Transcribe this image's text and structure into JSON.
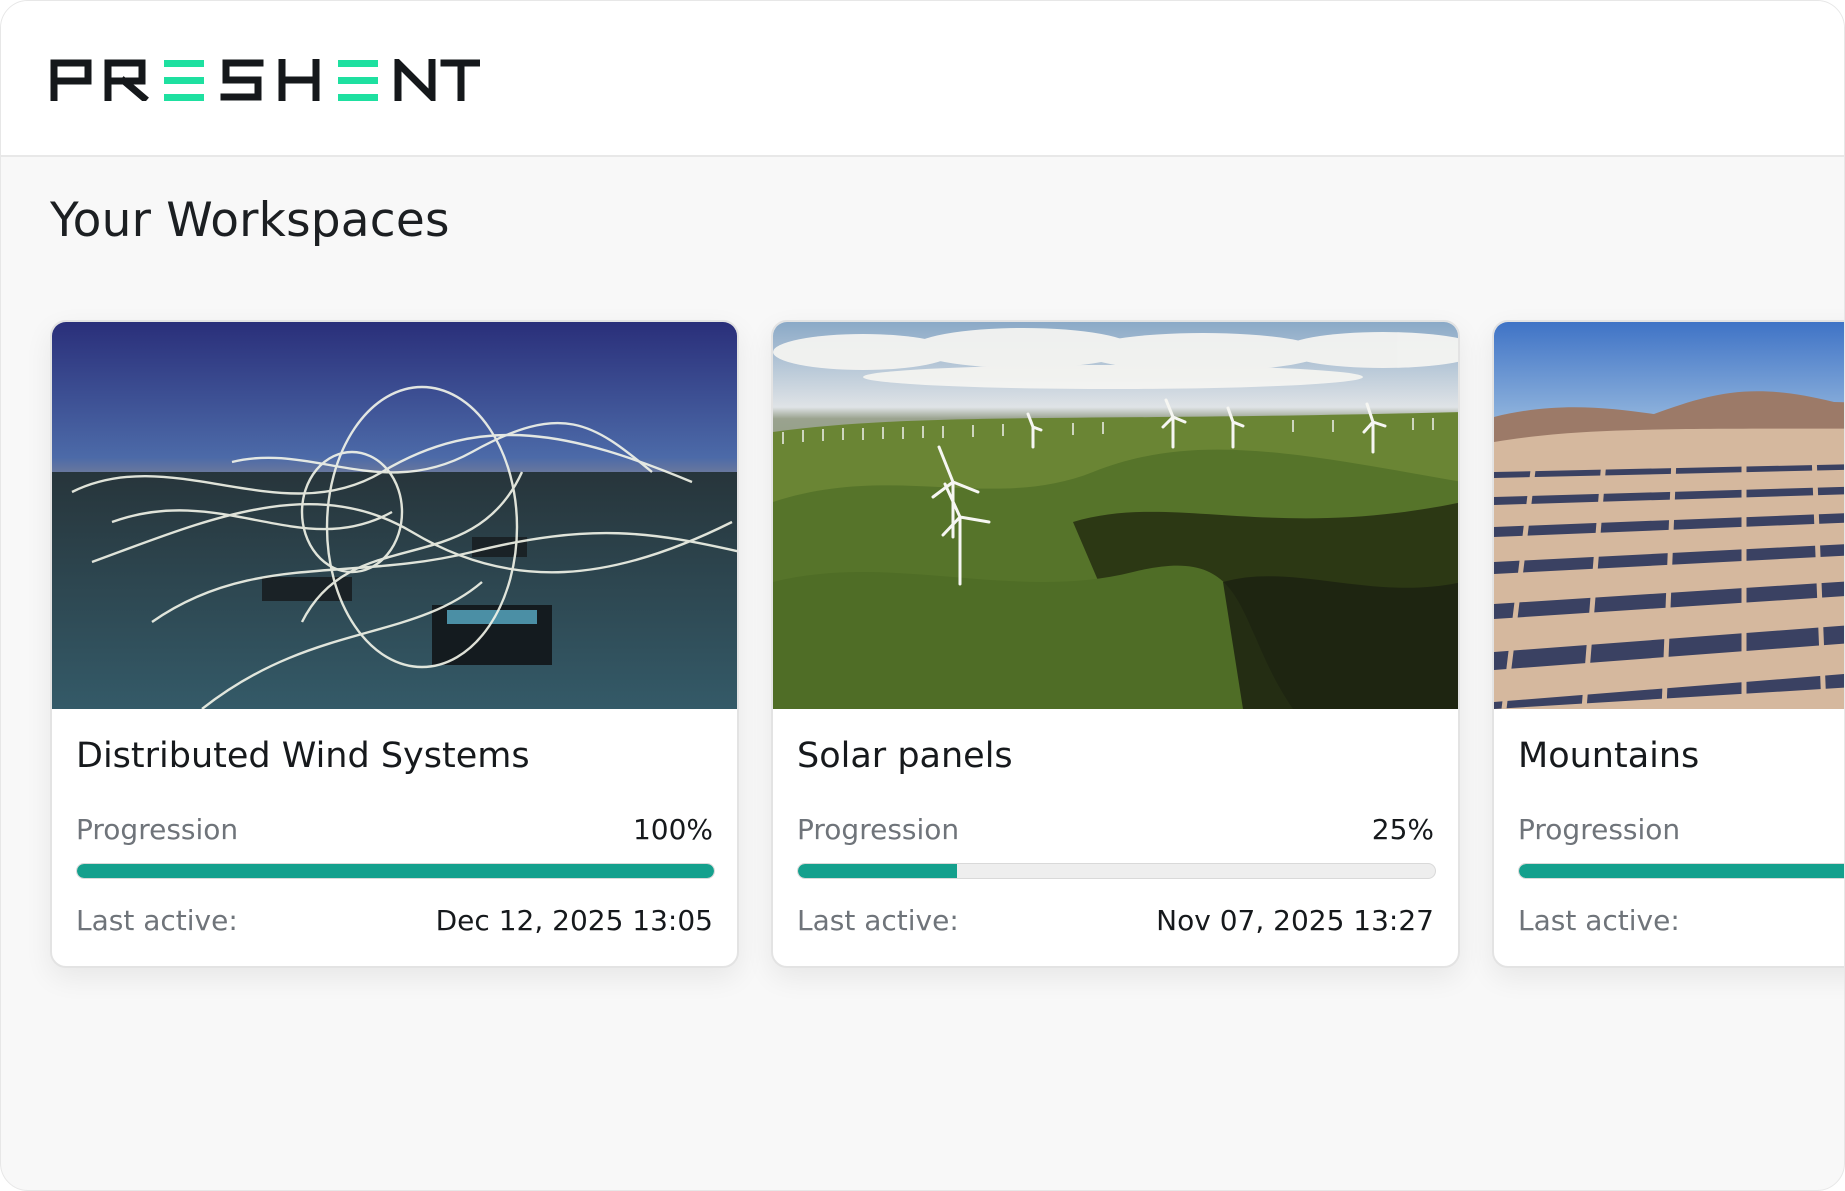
{
  "brand": {
    "name": "PRESHENT",
    "accent": "#1ee0a0",
    "dark": "#15181b"
  },
  "page": {
    "title": "Your Workspaces"
  },
  "colors": {
    "progress_fill": "#14a08d",
    "progress_track": "#eeeeee"
  },
  "workspaces": [
    {
      "name": "Distributed Wind Systems",
      "image": "light-trails-rooftop-dusk",
      "progression_label": "Progression",
      "progression_value": "100%",
      "progression": 1.0,
      "last_active_label": "Last active:",
      "last_active": "Dec 12, 2025 13:05"
    },
    {
      "name": "Solar panels",
      "image": "wind-turbines-green-hills",
      "progression_label": "Progression",
      "progression_value": "25%",
      "progression": 0.25,
      "last_active_label": "Last active:",
      "last_active": "Nov 07, 2025 13:27"
    },
    {
      "name": "Mountains",
      "image": "solar-farm-desert-mountains",
      "progression_label": "Progression",
      "progression": 1.0,
      "last_active_label": "Last active:"
    }
  ]
}
